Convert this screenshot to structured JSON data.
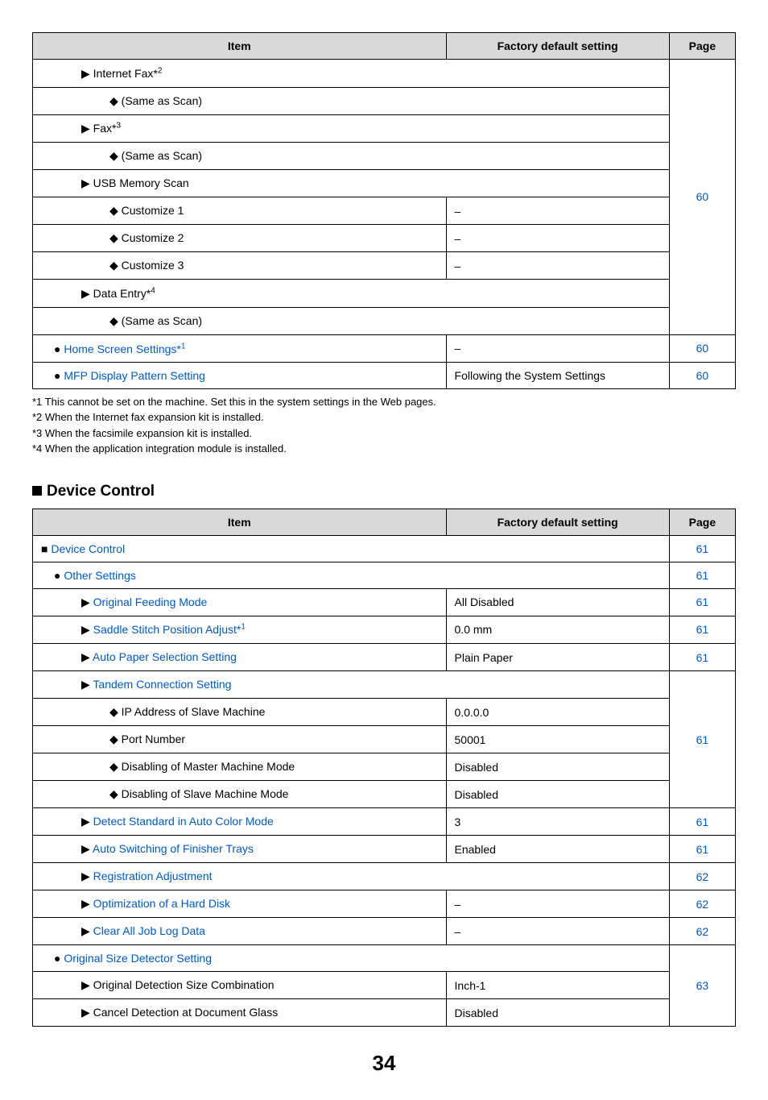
{
  "table1": {
    "headers": {
      "item": "Item",
      "default": "Factory default setting",
      "page": "Page"
    },
    "rows": [
      {
        "item": "Internet Fax*2",
        "sup": true,
        "bullet": "tri",
        "indent": 2,
        "spanItem": true
      },
      {
        "item": "(Same as Scan)",
        "bullet": "dia",
        "indent": 3,
        "spanItem": true
      },
      {
        "item": "Fax*3",
        "sup": true,
        "bullet": "tri",
        "indent": 2,
        "spanItem": true
      },
      {
        "item": "(Same as Scan)",
        "bullet": "dia",
        "indent": 3,
        "spanItem": true
      },
      {
        "item": "USB Memory Scan",
        "bullet": "tri",
        "indent": 2,
        "spanItem": true
      },
      {
        "item": "Customize 1",
        "bullet": "dia",
        "indent": 3,
        "default": "–"
      },
      {
        "item": "Customize 2",
        "bullet": "dia",
        "indent": 3,
        "default": "–"
      },
      {
        "item": "Customize 3",
        "bullet": "dia",
        "indent": 3,
        "default": "–"
      },
      {
        "item": "Data Entry*4",
        "sup": true,
        "bullet": "tri",
        "indent": 2,
        "spanItem": true
      },
      {
        "item": "(Same as Scan)",
        "bullet": "dia",
        "indent": 3,
        "spanItem": true
      }
    ],
    "page_group": "60",
    "bottom": [
      {
        "item": "Home Screen Settings*1",
        "sup": true,
        "bullet": "circle",
        "indent": 1,
        "link": true,
        "default": "–",
        "page": "60"
      },
      {
        "item": "MFP Display Pattern Setting",
        "bullet": "circle",
        "indent": 1,
        "link": true,
        "default": "Following the System Settings",
        "page": "60"
      }
    ]
  },
  "notes": [
    "*1  This cannot be set on the machine. Set this in the system settings in the Web pages.",
    "*2  When the Internet fax expansion kit is installed.",
    "*3  When the facsimile expansion kit is installed.",
    "*4  When the application integration module is installed."
  ],
  "section2": {
    "title": "Device Control",
    "headers": {
      "item": "Item",
      "default": "Factory default setting",
      "page": "Page"
    },
    "row_devcontrol": {
      "item": "Device Control",
      "page": "61"
    },
    "row_other": {
      "item": "Other Settings",
      "page": "61"
    },
    "row_ofm": {
      "item": "Original Feeding Mode",
      "default": "All Disabled",
      "page": "61"
    },
    "row_saddle": {
      "item": "Saddle Stitch Position Adjust*1",
      "default": "0.0 mm",
      "page": "61"
    },
    "row_autopaper": {
      "item": "Auto Paper Selection Setting",
      "default": "Plain Paper",
      "page": "61"
    },
    "row_tandem_head": {
      "item": "Tandem Connection Setting"
    },
    "tandem_rows": [
      {
        "item": "IP Address of Slave Machine",
        "default": "0.0.0.0"
      },
      {
        "item": "Port Number",
        "default": "50001"
      },
      {
        "item": "Disabling of Master Machine Mode",
        "default": "Disabled"
      },
      {
        "item": "Disabling of Slave Machine Mode",
        "default": "Disabled"
      }
    ],
    "tandem_page": "61",
    "row_detect": {
      "item": "Detect Standard in Auto Color Mode",
      "default": "3",
      "page": "61"
    },
    "row_autoswitch": {
      "item": "Auto Switching of Finisher Trays",
      "default": "Enabled",
      "page": "61"
    },
    "row_reg": {
      "item": "Registration Adjustment",
      "page": "62"
    },
    "row_opt": {
      "item": "Optimization of a Hard Disk",
      "default": "–",
      "page": "62"
    },
    "row_clear": {
      "item": "Clear All Job Log Data",
      "default": "–",
      "page": "62"
    },
    "row_origsize_head": {
      "item": "Original Size Detector Setting"
    },
    "origsize_rows": [
      {
        "item": "Original Detection Size Combination",
        "default": "Inch-1"
      },
      {
        "item": "Cancel Detection at Document Glass",
        "default": "Disabled"
      }
    ],
    "origsize_page": "63"
  },
  "page_number": "34",
  "chart_data": {
    "type": "table",
    "tables": [
      {
        "title": "(continued settings)",
        "columns": [
          "Item",
          "Factory default setting",
          "Page"
        ],
        "rows": [
          [
            "Internet Fax*2",
            "",
            "60"
          ],
          [
            "(Same as Scan)",
            "",
            "60"
          ],
          [
            "Fax*3",
            "",
            "60"
          ],
          [
            "(Same as Scan)",
            "",
            "60"
          ],
          [
            "USB Memory Scan",
            "",
            "60"
          ],
          [
            "Customize 1",
            "–",
            "60"
          ],
          [
            "Customize 2",
            "–",
            "60"
          ],
          [
            "Customize 3",
            "–",
            "60"
          ],
          [
            "Data Entry*4",
            "",
            "60"
          ],
          [
            "(Same as Scan)",
            "",
            "60"
          ],
          [
            "Home Screen Settings*1",
            "–",
            "60"
          ],
          [
            "MFP Display Pattern Setting",
            "Following the System Settings",
            "60"
          ]
        ]
      },
      {
        "title": "Device Control",
        "columns": [
          "Item",
          "Factory default setting",
          "Page"
        ],
        "rows": [
          [
            "Device Control",
            "",
            "61"
          ],
          [
            "Other Settings",
            "",
            "61"
          ],
          [
            "Original Feeding Mode",
            "All Disabled",
            "61"
          ],
          [
            "Saddle Stitch Position Adjust*1",
            "0.0 mm",
            "61"
          ],
          [
            "Auto Paper Selection Setting",
            "Plain Paper",
            "61"
          ],
          [
            "Tandem Connection Setting",
            "",
            "61"
          ],
          [
            "IP Address of Slave Machine",
            "0.0.0.0",
            "61"
          ],
          [
            "Port Number",
            "50001",
            "61"
          ],
          [
            "Disabling of Master Machine Mode",
            "Disabled",
            "61"
          ],
          [
            "Disabling of Slave Machine Mode",
            "Disabled",
            "61"
          ],
          [
            "Detect Standard in Auto Color Mode",
            "3",
            "61"
          ],
          [
            "Auto Switching of Finisher Trays",
            "Enabled",
            "61"
          ],
          [
            "Registration Adjustment",
            "",
            "62"
          ],
          [
            "Optimization of a Hard Disk",
            "–",
            "62"
          ],
          [
            "Clear All Job Log Data",
            "–",
            "62"
          ],
          [
            "Original Size Detector Setting",
            "",
            "63"
          ],
          [
            "Original Detection Size Combination",
            "Inch-1",
            "63"
          ],
          [
            "Cancel Detection at Document Glass",
            "Disabled",
            "63"
          ]
        ]
      }
    ]
  }
}
